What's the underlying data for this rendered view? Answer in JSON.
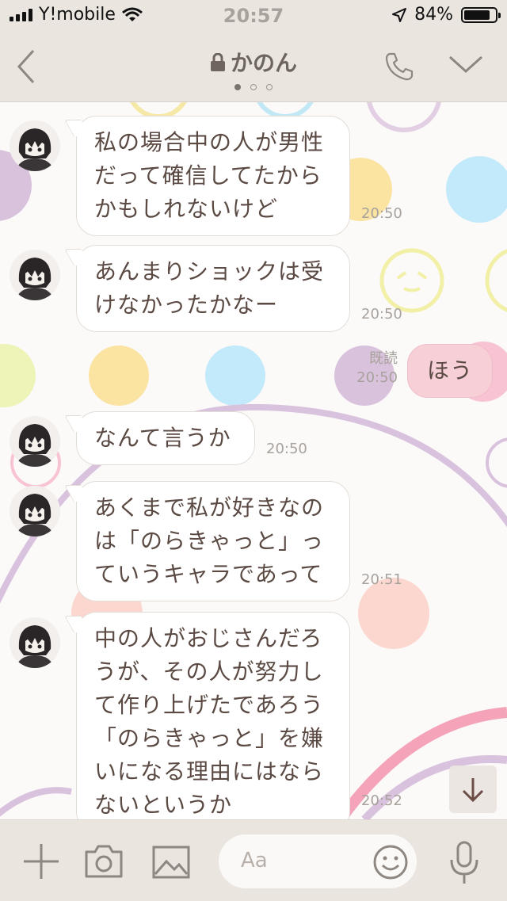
{
  "status_bar": {
    "carrier": "Y!mobile",
    "time": "20:57",
    "battery_text": "84%",
    "battery_level": 0.84
  },
  "header": {
    "title": "かのん",
    "page_dots": 3,
    "active_dot": 0
  },
  "messages": [
    {
      "from": "other",
      "text": "私の場合中の人が男性\nだって確信してたから\nかもしれないけど",
      "time": "20:50"
    },
    {
      "from": "other",
      "text": "あんまりショックは受\nけなかったかなー",
      "time": "20:50"
    },
    {
      "from": "me",
      "text": "ほう",
      "read_label": "既読",
      "time": "20:50"
    },
    {
      "from": "other",
      "text": "なんて言うか",
      "time": "20:50"
    },
    {
      "from": "other",
      "text": "あくまで私が好きなの\nは「のらきゃっと」っ\nていうキャラであって",
      "time": "20:51"
    },
    {
      "from": "other",
      "text": "中の人がおじさんだろ\nうが、その人が努力し\nて作り上げたであろう\n「のらきゃっと」を嫌\nいになる理由にはなら\nないというか",
      "time": "20:52"
    }
  ],
  "composer": {
    "placeholder": "Aa"
  },
  "icons": {
    "back": "chevron-left-icon",
    "lock": "lock-icon",
    "call": "phone-icon",
    "menu": "chevron-down-icon",
    "add": "plus-icon",
    "camera": "camera-icon",
    "image": "image-icon",
    "emoji": "smiley-icon",
    "mic": "microphone-icon",
    "scroll": "arrow-down-icon"
  },
  "colors": {
    "bar_bg": "#ebe5e0",
    "bubble_text": "#5b4a43",
    "my_bubble": "#f7cfd7"
  }
}
